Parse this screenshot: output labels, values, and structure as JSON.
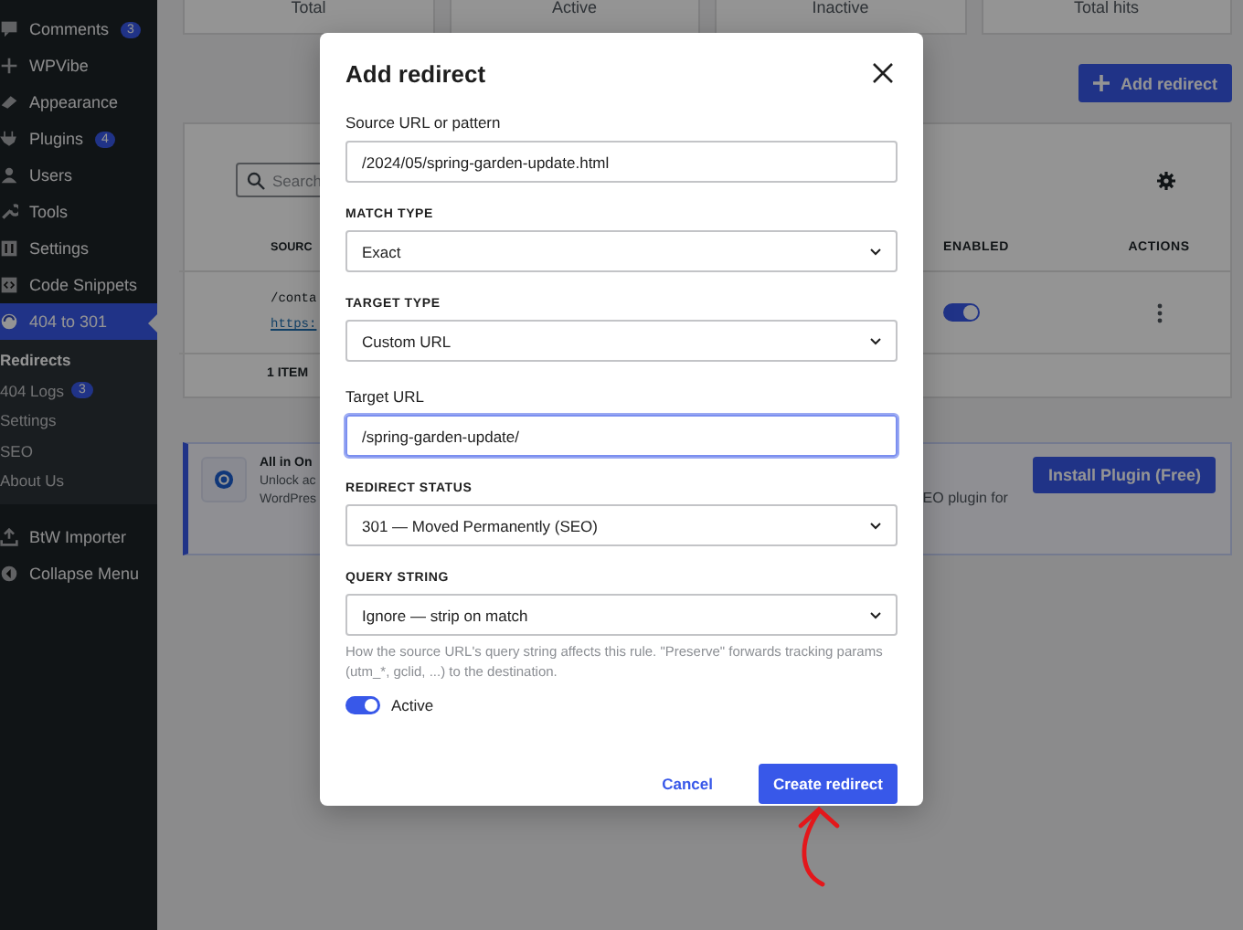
{
  "sidebar": {
    "items": [
      {
        "label": "Comments",
        "badge": "3",
        "selected": false
      },
      {
        "label": "WPVibe",
        "selected": false
      },
      {
        "label": "Appearance",
        "selected": false
      },
      {
        "label": "Plugins",
        "badge": "4",
        "selected": false
      },
      {
        "label": "Users",
        "selected": false
      },
      {
        "label": "Tools",
        "selected": false
      },
      {
        "label": "Settings",
        "selected": false
      },
      {
        "label": "Code Snippets",
        "selected": false
      },
      {
        "label": "404 to 301",
        "selected": true,
        "children": [
          {
            "label": "Redirects",
            "selected": true
          },
          {
            "label": "404 Logs",
            "badge": "3",
            "selected": false
          },
          {
            "label": "Settings",
            "selected": false
          },
          {
            "label": "SEO",
            "selected": false
          },
          {
            "label": "About Us",
            "selected": false
          }
        ]
      },
      {
        "label": "BtW Importer",
        "selected": false
      },
      {
        "label": "Collapse Menu",
        "selected": false
      }
    ]
  },
  "stats": [
    {
      "label": "Total"
    },
    {
      "label": "Active"
    },
    {
      "label": "Inactive"
    },
    {
      "label": "Total hits"
    }
  ],
  "add_button": "Add redirect",
  "table": {
    "search_placeholder": "Search",
    "columns": [
      "SOURC",
      "ENABLED",
      "ACTIONS"
    ],
    "rows": [
      {
        "source": "/conta",
        "target": "https:",
        "enabled": true
      }
    ],
    "footer": "1 ITEM"
  },
  "notice": {
    "title": "All in On",
    "lines": [
      "Unlock ac",
      "WordPres"
    ],
    "fragment": "EO plugin for",
    "button": "Install Plugin (Free)"
  },
  "modal": {
    "title": "Add redirect",
    "fields": [
      {
        "kind": "text",
        "label": "Source URL or pattern",
        "value": "/2024/05/spring-garden-update.html",
        "focused": false
      },
      {
        "kind": "select",
        "label": "MATCH TYPE",
        "value": "Exact"
      },
      {
        "kind": "select",
        "label": "TARGET TYPE",
        "value": "Custom URL"
      },
      {
        "kind": "text",
        "label": "Target URL",
        "value": "/spring-garden-update/",
        "focused": true
      },
      {
        "kind": "select",
        "label": "REDIRECT STATUS",
        "value": "301 — Moved Permanently (SEO)"
      },
      {
        "kind": "select",
        "label": "QUERY STRING",
        "value": "Ignore — strip on match"
      }
    ],
    "help": "How the source URL's query string affects this rule. \"Preserve\" forwards tracking params (utm_*, gclid, ...) to the destination.",
    "active": {
      "label": "Active",
      "on": true
    },
    "cancel": "Cancel",
    "submit": "Create redirect"
  }
}
